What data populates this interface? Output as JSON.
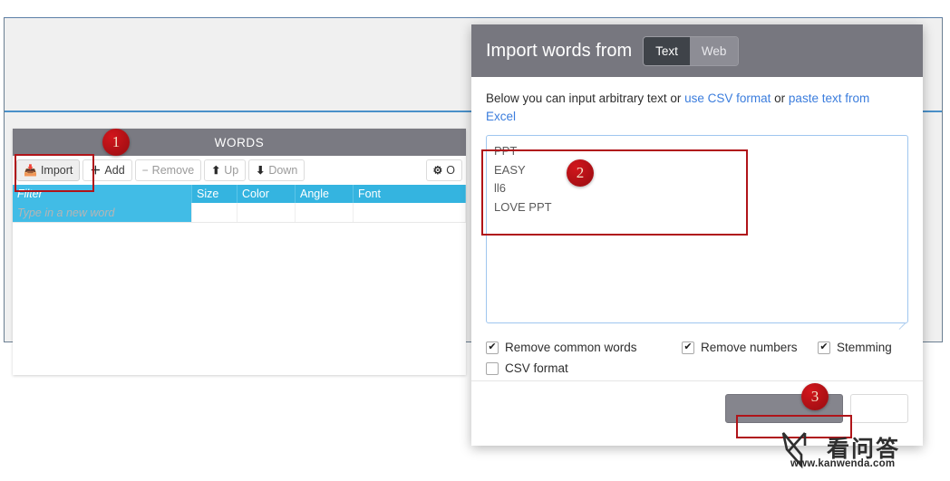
{
  "app": {
    "words_panel": {
      "title": "WORDS",
      "toolbar": [
        {
          "label": "Import",
          "icon": "import-icon",
          "glyph": "⬇",
          "state": "pressed"
        },
        {
          "label": "Add",
          "icon": "plus-icon",
          "glyph": "＋",
          "state": "enabled"
        },
        {
          "label": "Remove",
          "icon": "minus-icon",
          "glyph": "−",
          "state": "disabled"
        },
        {
          "label": "Up",
          "icon": "arrow-up-icon",
          "glyph": "⬆",
          "state": "disabled"
        },
        {
          "label": "Down",
          "icon": "arrow-down-icon",
          "glyph": "⬇",
          "state": "disabled"
        }
      ],
      "options_button": {
        "label": "O",
        "icon": "gear-icon",
        "glyph": "⚙"
      },
      "table": {
        "columns": [
          "Filter",
          "Size",
          "Color",
          "Angle",
          "Font"
        ],
        "new_row_placeholder": "Type in a new word",
        "rows": []
      }
    }
  },
  "modal": {
    "title": "Import words from",
    "tabs": [
      {
        "label": "Text",
        "active": true
      },
      {
        "label": "Web",
        "active": false
      }
    ],
    "hint": {
      "prefix": "Below you can input arbitrary text or ",
      "link1": "use CSV format",
      "middle": " or ",
      "link2": "paste text from Excel"
    },
    "textarea": {
      "value": "PPT\nEASY\nll6\nLOVE PPT",
      "placeholder": ""
    },
    "options": [
      {
        "label": "Remove common words",
        "checked": true
      },
      {
        "label": "Remove numbers",
        "checked": true
      },
      {
        "label": "Stemming",
        "checked": true
      },
      {
        "label": "CSV format",
        "checked": false
      }
    ],
    "footer": {
      "primary_label": "",
      "secondary_label": ""
    }
  },
  "annotations": {
    "badges": [
      "1",
      "2",
      "3"
    ],
    "highlight_color": "#b01419"
  },
  "watermark": {
    "brand_cn": "看问答",
    "url": "www.kanwenda.com"
  }
}
